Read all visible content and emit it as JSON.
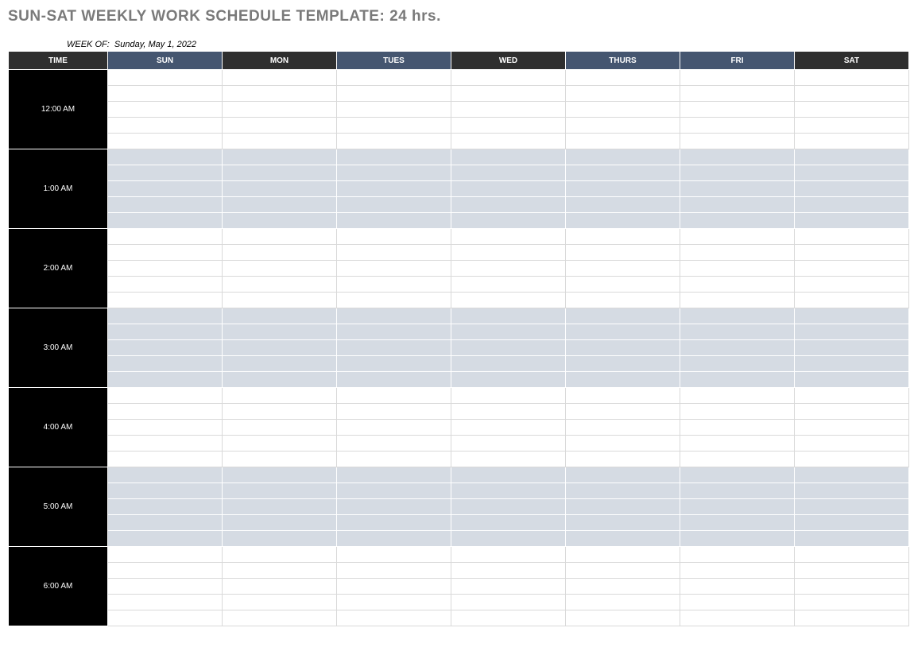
{
  "title": "SUN-SAT WEEKLY WORK SCHEDULE TEMPLATE: 24 hrs.",
  "week_of_label": "WEEK OF:",
  "week_of_value": "Sunday, May 1, 2022",
  "headers": {
    "time": "TIME",
    "sun": "SUN",
    "mon": "MON",
    "tues": "TUES",
    "wed": "WED",
    "thurs": "THURS",
    "fri": "FRI",
    "sat": "SAT"
  },
  "hours": [
    "12:00 AM",
    "1:00 AM",
    "2:00 AM",
    "3:00 AM",
    "4:00 AM",
    "5:00 AM",
    "6:00 AM"
  ],
  "subrows_per_hour": 5
}
